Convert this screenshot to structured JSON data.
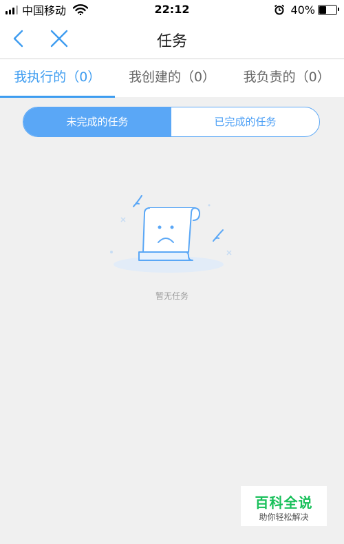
{
  "status_bar": {
    "carrier": "中国移动",
    "time": "22:12",
    "battery": "40%",
    "battery_level": 0.4
  },
  "nav": {
    "title": "任务"
  },
  "tabs": [
    {
      "label": "我执行的（0）",
      "active": true
    },
    {
      "label": "我创建的（0）",
      "active": false
    },
    {
      "label": "我负责的（0）",
      "active": false
    }
  ],
  "segment": {
    "options": [
      "未完成的任务",
      "已完成的任务"
    ],
    "selected": 0
  },
  "empty_state": {
    "message": "暂无任务"
  },
  "watermark": {
    "title": "百科全说",
    "subtitle": "助你轻松解决"
  },
  "colors": {
    "accent": "#3d9cf0",
    "segment_active": "#5aa7f6",
    "background": "#f0f0f0",
    "watermark_green": "#18c05a"
  }
}
